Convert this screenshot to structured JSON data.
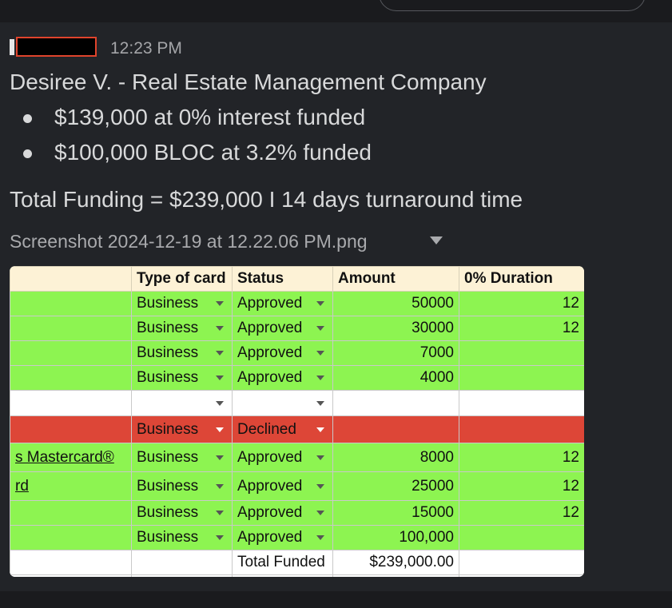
{
  "message": {
    "timestamp": "12:23 PM",
    "headline": "Desiree V. - Real Estate Management Company",
    "bullets": [
      "$139,000 at 0% interest funded",
      "$100,000 BLOC at 3.2% funded"
    ],
    "total": "Total Funding = $239,000 I 14 days turnaround time",
    "attachment_name": "Screenshot 2024-12-19 at 12.22.06 PM.png"
  },
  "sheet": {
    "headers": [
      "",
      "Type of card",
      "Status",
      "Amount",
      "0% Duration"
    ],
    "rows": [
      {
        "name": "",
        "type": "Business",
        "status": "Approved",
        "amount": "50000",
        "duration": "12"
      },
      {
        "name": "",
        "type": "Business",
        "status": "Approved",
        "amount": "30000",
        "duration": "12"
      },
      {
        "name": "",
        "type": "Business",
        "status": "Approved",
        "amount": "7000",
        "duration": ""
      },
      {
        "name": "",
        "type": "Business",
        "status": "Approved",
        "amount": "4000",
        "duration": ""
      },
      {
        "name": "",
        "type": "",
        "status": "",
        "amount": "",
        "duration": ""
      },
      {
        "name": "",
        "type": "Business",
        "status": "Declined",
        "amount": "",
        "duration": ""
      },
      {
        "name": "s Mastercard®",
        "type": "Business",
        "status": "Approved",
        "amount": "8000",
        "duration": "12"
      },
      {
        "name": "rd",
        "type": "Business",
        "status": "Approved",
        "amount": "25000",
        "duration": "12"
      },
      {
        "name": "",
        "type": "Business",
        "status": "Approved",
        "amount": "15000",
        "duration": "12"
      },
      {
        "name": "",
        "type": "Business",
        "status": "Approved",
        "amount": "100,000",
        "duration": ""
      }
    ],
    "total_label": "Total Funded",
    "total_value": "$239,000.00"
  },
  "colors": {
    "approved_row": "#8df451",
    "declined_row": "#dd4637",
    "header_row": "#fdf2d6"
  }
}
